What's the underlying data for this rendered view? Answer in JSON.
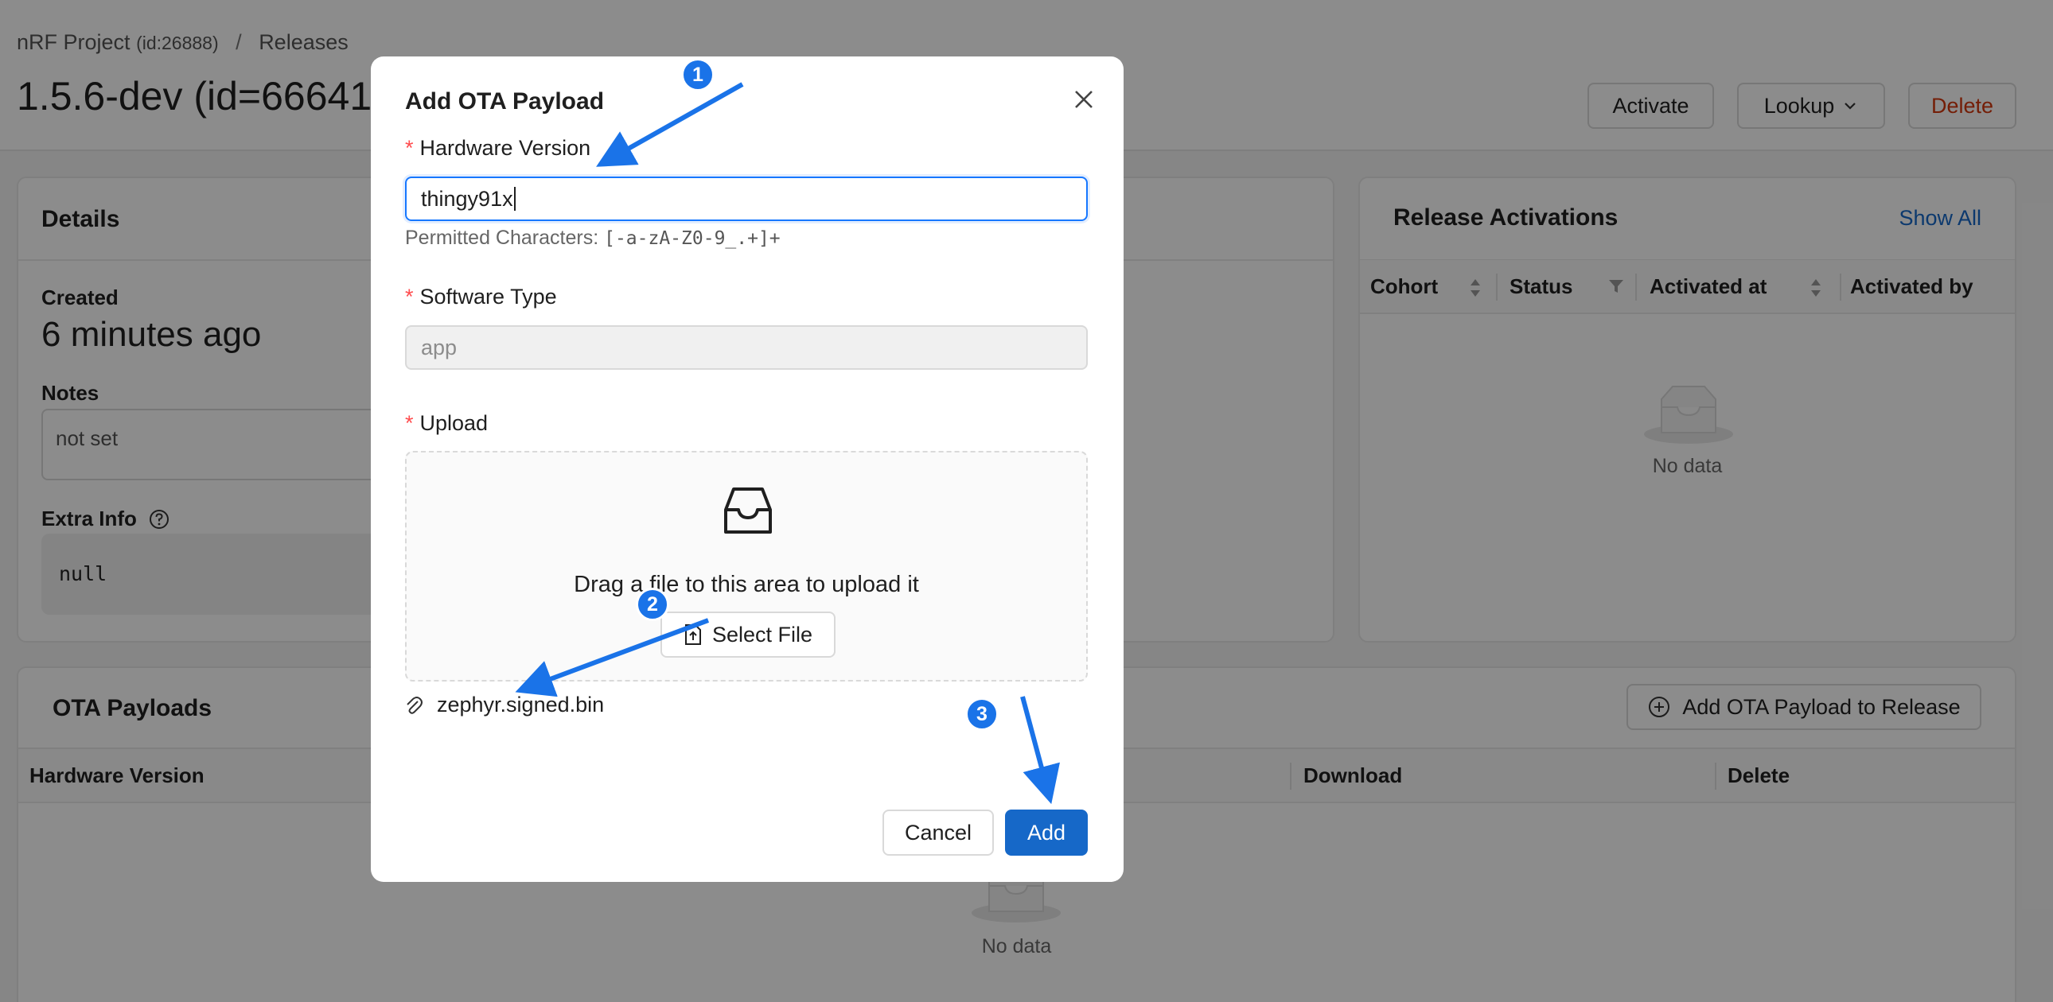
{
  "breadcrumb": {
    "project": "nRF Project",
    "project_id": "(id:26888)",
    "separator": "/",
    "section": "Releases"
  },
  "page": {
    "title": "1.5.6-dev (id=66641)"
  },
  "header_buttons": {
    "activate": "Activate",
    "lookup": "Lookup",
    "delete": "Delete"
  },
  "details": {
    "title": "Details",
    "created_label": "Created",
    "created_value": "6 minutes ago",
    "notes_label": "Notes",
    "notes_value": "not set",
    "extra_label": "Extra Info",
    "extra_value": "null"
  },
  "activations": {
    "title": "Release Activations",
    "show_all": "Show All",
    "columns": [
      "Cohort",
      "Status",
      "Activated at",
      "Activated by"
    ],
    "empty": "No data"
  },
  "payloads": {
    "title": "OTA Payloads",
    "add_button": "Add OTA Payload to Release",
    "columns": [
      "Hardware Version",
      "Download",
      "Delete"
    ],
    "empty": "No data"
  },
  "modal": {
    "title": "Add OTA Payload",
    "required_mark": "*",
    "hw_label": "Hardware Version",
    "hw_value": "thingy91x",
    "help_prefix": "Permitted Characters:",
    "help_pattern": "[-a-zA-Z0-9_.+]+",
    "sw_label": "Software Type",
    "sw_value": "app",
    "upload_label": "Upload",
    "drop_text": "Drag a file to this area to upload it",
    "select_file": "Select File",
    "file_name": "zephyr.signed.bin",
    "cancel": "Cancel",
    "add": "Add"
  },
  "annotations": {
    "step1": "1",
    "step2": "2",
    "step3": "3",
    "color": "#1a73e8"
  },
  "icons": [
    "close-icon",
    "inbox-icon",
    "upload-file-icon",
    "paperclip-icon",
    "chevron-down-icon",
    "question-circle-icon",
    "plus-circle-icon",
    "sort-icon",
    "filter-icon",
    "empty-inbox-icon"
  ]
}
